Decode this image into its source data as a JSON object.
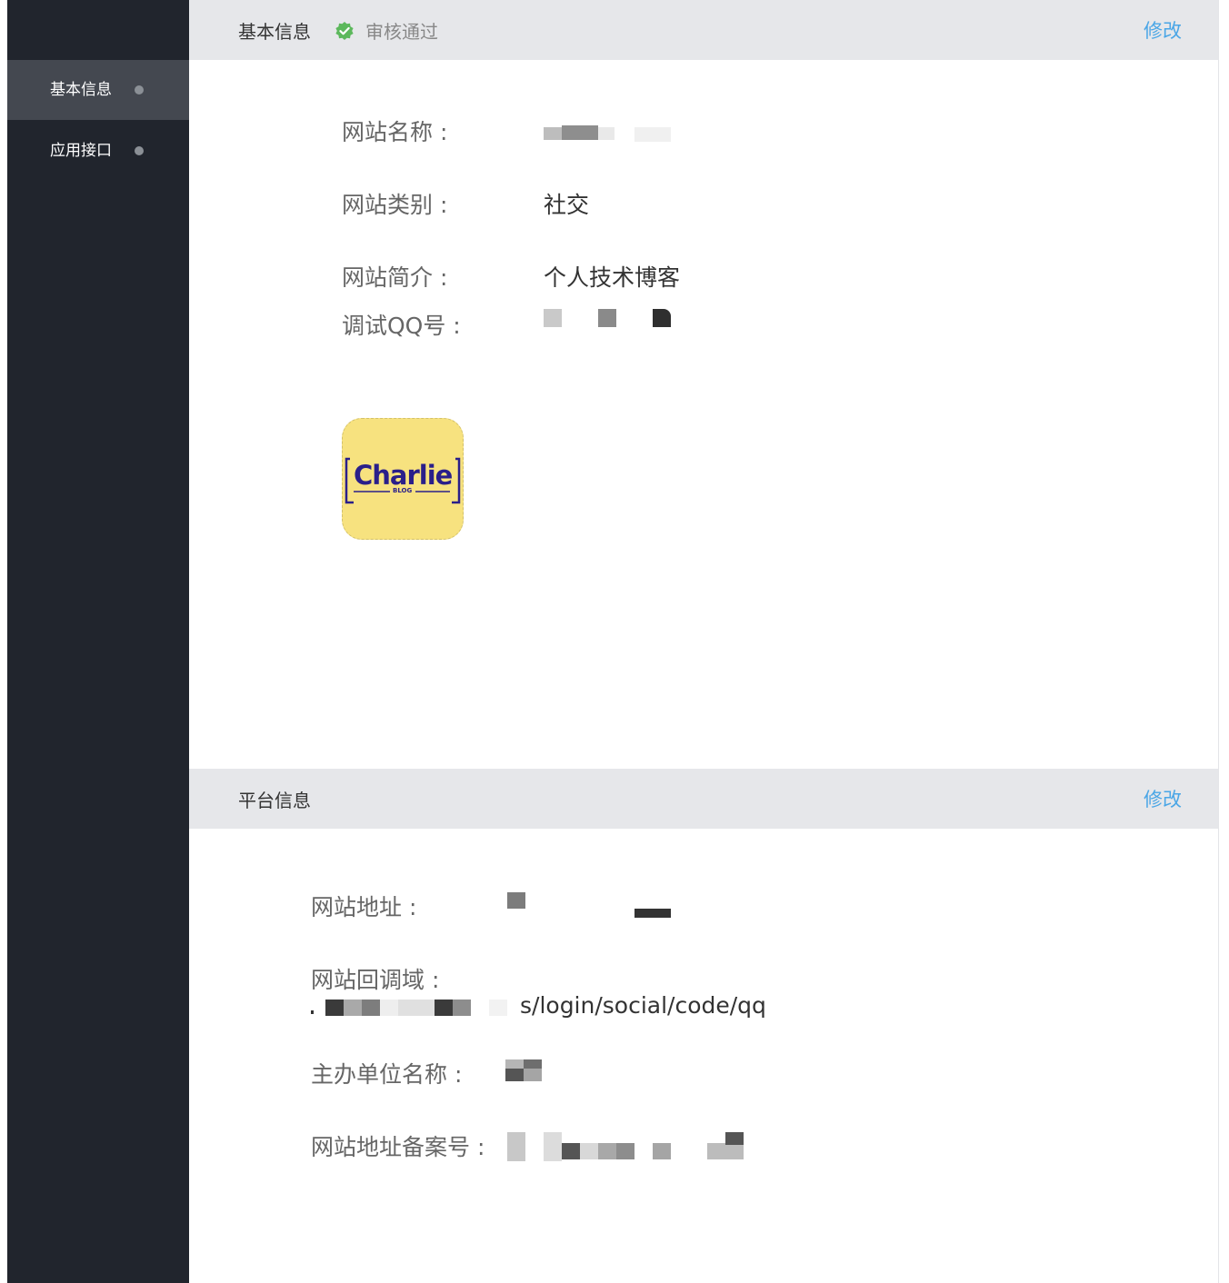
{
  "sidebar": {
    "items": [
      {
        "label": "基本信息",
        "active": true
      },
      {
        "label": "应用接口",
        "active": false
      }
    ]
  },
  "basic": {
    "title": "基本信息",
    "status": "审核通过",
    "edit": "修改",
    "fields": [
      {
        "label": "网站名称 :",
        "value": ""
      },
      {
        "label": "网站类别 :",
        "value": "社交"
      },
      {
        "label": "网站简介 :",
        "value": "个人技术博客"
      },
      {
        "label": "调试QQ号 :",
        "value": ""
      }
    ],
    "logo_text": "Charlie",
    "logo_sub": "BLOG"
  },
  "platform": {
    "title": "平台信息",
    "edit": "修改",
    "fields": [
      {
        "label": "网站地址 :",
        "value": ""
      },
      {
        "label": "网站回调域 :",
        "value": "s/login/social/code/qq"
      },
      {
        "label": "主办单位名称 :",
        "value": ""
      },
      {
        "label": "网站地址备案号 :",
        "value": ""
      }
    ]
  },
  "colors": {
    "accent": "#4aa6e6",
    "sidebar_bg": "#21252d",
    "status_green": "#5cb85c"
  }
}
